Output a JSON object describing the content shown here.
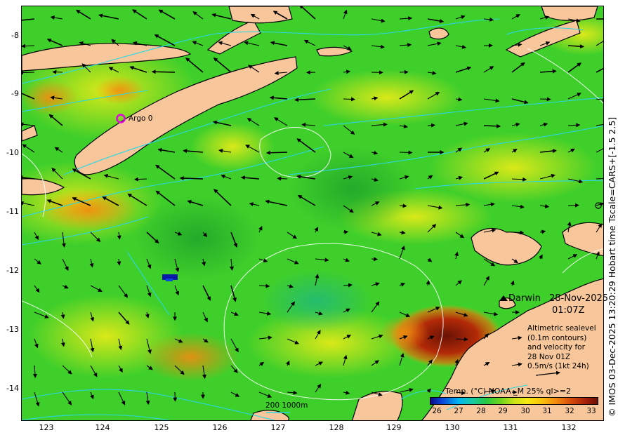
{
  "map": {
    "side_text": "© IMOS 03-Dec-2025 13:20:29 Hobart time Tscale=CARS+[-1.5 2.5]",
    "date_line1": "28-Nov-2025",
    "date_line2": "01:07Z",
    "darwin_label": "Darwin",
    "argo_label": "Argo 0",
    "altimetry_note": [
      "Altimetric sealevel",
      "(0.1m contours)",
      "and velocity for",
      "28 Nov 01Z",
      "0.5m/s (1kt 24h)"
    ],
    "bathymetry_scale_label": "200  1000m",
    "temperature_title": "Temp. (°C) NOAA _M 25% ql>=2",
    "colorbar_ticks": [
      "26",
      "27",
      "28",
      "29",
      "30",
      "31",
      "32",
      "33"
    ],
    "latitude_ticks": [
      "-8",
      "-9",
      "-10",
      "-11",
      "-12",
      "-13",
      "-14"
    ],
    "longitude_ticks": [
      "123",
      "124",
      "125",
      "126",
      "127",
      "128",
      "129",
      "130",
      "131",
      "132"
    ],
    "colors": {
      "land": "#f7c79b",
      "sst_green": "#3fcf2a",
      "sst_yellow": "#d8e61a",
      "sst_orange": "#f08a10",
      "sst_hot": "#9a1d07",
      "bathy_contour": "#2ad7e6",
      "argo_marker": "#e000e0"
    }
  }
}
